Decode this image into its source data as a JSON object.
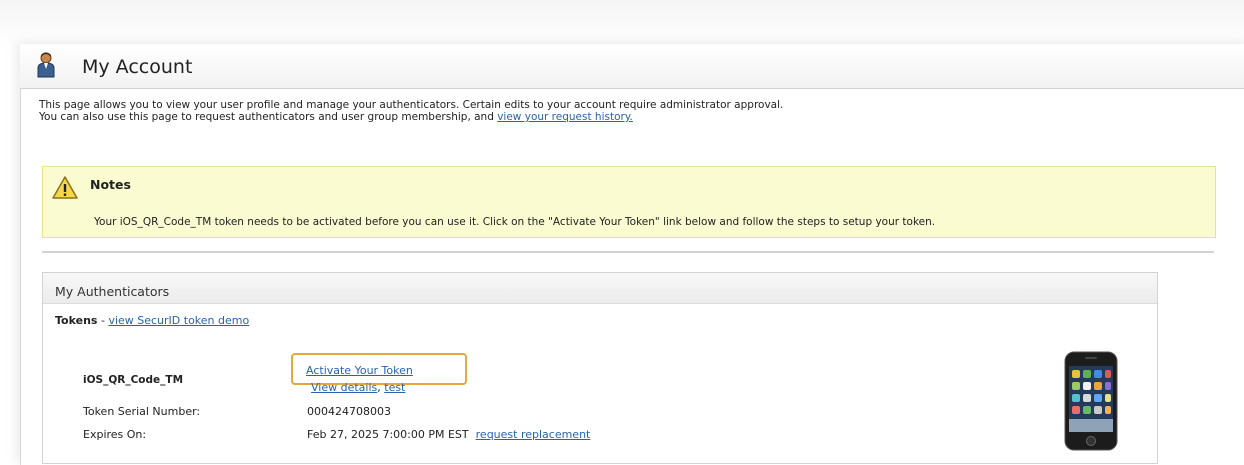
{
  "page": {
    "title": "My Account"
  },
  "intro": {
    "line1": "This page allows you to view your user profile and manage your authenticators. Certain edits to your account require administrator approval.",
    "line2_prefix": "You can also use this page to request authenticators and user group membership, and ",
    "history_link": "view your request history."
  },
  "notes": {
    "title": "Notes",
    "text": "Your iOS_QR_Code_TM token needs to be activated before you can use it. Click on the \"Activate Your Token\" link below and follow the steps to setup your token."
  },
  "authenticators": {
    "title": "My Authenticators",
    "tokens_label": "Tokens",
    "tokens_sep": " - ",
    "demo_link": "view SecurID token demo",
    "token": {
      "name": "iOS_QR_Code_TM",
      "activate_link": "Activate Your Token",
      "details_link": "View details",
      "details_sep": ", ",
      "test_link": "test",
      "serial_label": "Token Serial Number:",
      "serial_value": "000424708003",
      "expires_label": "Expires On:",
      "expires_value": "Feb 27, 2025 7:00:00 PM EST",
      "replacement_link": "request replacement"
    }
  },
  "icons": {
    "user": "user-icon",
    "warning": "warning-icon",
    "phone": "smartphone-icon"
  },
  "colors": {
    "link": "#2a63a8",
    "notes_bg": "#fafbd0",
    "highlight": "#e9a63a"
  }
}
